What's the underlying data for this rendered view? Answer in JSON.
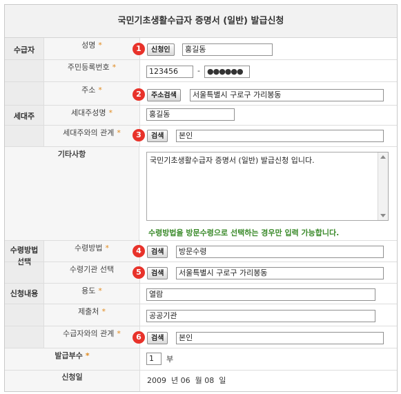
{
  "title": "국민기초생활수급자 증명서 (일반) 발급신청",
  "categories": {
    "recipient": "수급자",
    "household": "세대주",
    "receive_line1": "수령방법",
    "receive_line2": "선택",
    "apply": "신청내용"
  },
  "required_mark": "*",
  "labels": {
    "name": "성명",
    "rrn": "주민등록번호",
    "address": "주소",
    "household_name": "세대주성명",
    "household_relation": "세대주와의 관계",
    "etc": "기타사항",
    "receive_method": "수령방법",
    "receive_agency": "수령기관 선택",
    "purpose": "용도",
    "submit_to": "제출처",
    "recipient_relation": "수급자와의 관계",
    "copies": "발급부수",
    "apply_date": "신청일"
  },
  "badges": [
    "1",
    "2",
    "3",
    "4",
    "5",
    "6"
  ],
  "buttons": {
    "applicant": "신청인",
    "address_search": "주소검색",
    "search": "검색"
  },
  "values": {
    "name": "홍길동",
    "rrn_front": "123456",
    "rrn_sep": "-",
    "rrn_back": "●●●●●●",
    "address": "서울특별시 구로구 가리봉동",
    "household_name": "홍길동",
    "household_relation": "본인",
    "etc_text": "국민기초생활수급자 증명서 (일반) 발급신청 입니다.",
    "etc_note": "수령방법을 방문수령으로 선택하는 경우만 입력 가능합니다.",
    "receive_method": "방문수령",
    "receive_agency": "서울특별시 구로구 가리봉동",
    "purpose": "열람",
    "submit_to": "공공기관",
    "recipient_relation": "본인",
    "copies": "1",
    "copies_unit": "부",
    "apply_date": "2009  년 06  월 08  일"
  }
}
